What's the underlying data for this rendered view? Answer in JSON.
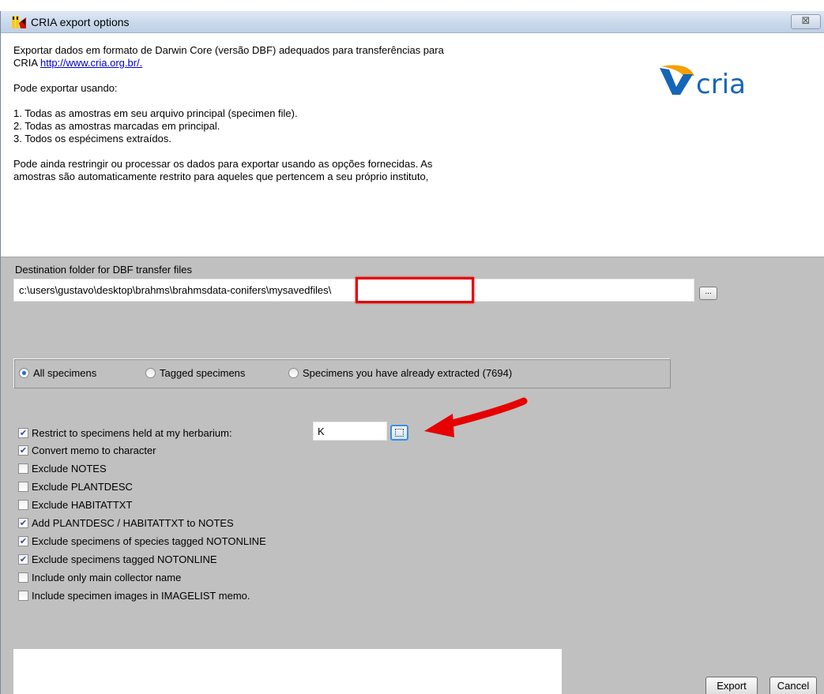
{
  "window": {
    "title": "CRIA export options",
    "close_glyph": "⊠",
    "app_icon": "app-window-icon"
  },
  "info": {
    "line1": "Exportar dados em formato de Darwin Core (versão DBF) adequados para transferências para",
    "line2_prefix": "CRIA ",
    "link": "http://www.cria.org.br/.",
    "line3": "Pode exportar usando:",
    "line4": "1. Todas as amostras em seu arquivo principal (specimen file).",
    "line5": "2. Todas as amostras marcadas em principal.",
    "line6": "3. Todos os espécimens extraídos.",
    "line7": "Pode ainda restringir ou processar os dados para exportar usando as opções fornecidas. As",
    "line8": "amostras são automaticamente restrito para aqueles que pertencem a seu próprio instituto,"
  },
  "logo": {
    "text": "cria",
    "accent_orange": "#f5a000",
    "accent_blue": "#1565b8"
  },
  "destination": {
    "label": "Destination folder for DBF transfer files",
    "path": "c:\\users\\gustavo\\desktop\\brahms\\brahmsdata-conifers\\mysavedfiles\\",
    "browse_label": "..."
  },
  "scope": {
    "options": [
      {
        "label": "All specimens",
        "selected": true
      },
      {
        "label": "Tagged specimens",
        "selected": false
      },
      {
        "label": "Specimens you have already extracted  (7694)",
        "selected": false
      }
    ]
  },
  "options": [
    {
      "label": "Restrict to specimens held at my herbarium:",
      "checked": true
    },
    {
      "label": "Convert memo to character",
      "checked": true
    },
    {
      "label": "Exclude NOTES",
      "checked": false
    },
    {
      "label": "Exclude PLANTDESC",
      "checked": false
    },
    {
      "label": "Exclude HABITATTXT",
      "checked": false
    },
    {
      "label": "Add PLANTDESC / HABITATTXT to NOTES",
      "checked": true
    },
    {
      "label": "Exclude specimens of species tagged NOTONLINE",
      "checked": true
    },
    {
      "label": "Exclude specimens tagged NOTONLINE",
      "checked": true
    },
    {
      "label": "Include only main collector name",
      "checked": false
    },
    {
      "label": "Include specimen images in IMAGELIST memo.",
      "checked": false
    }
  ],
  "herbarium": {
    "value": "K"
  },
  "annotation": {
    "highlight_color": "#e60000"
  },
  "buttons": {
    "export": "Export",
    "cancel": "Cancel"
  }
}
